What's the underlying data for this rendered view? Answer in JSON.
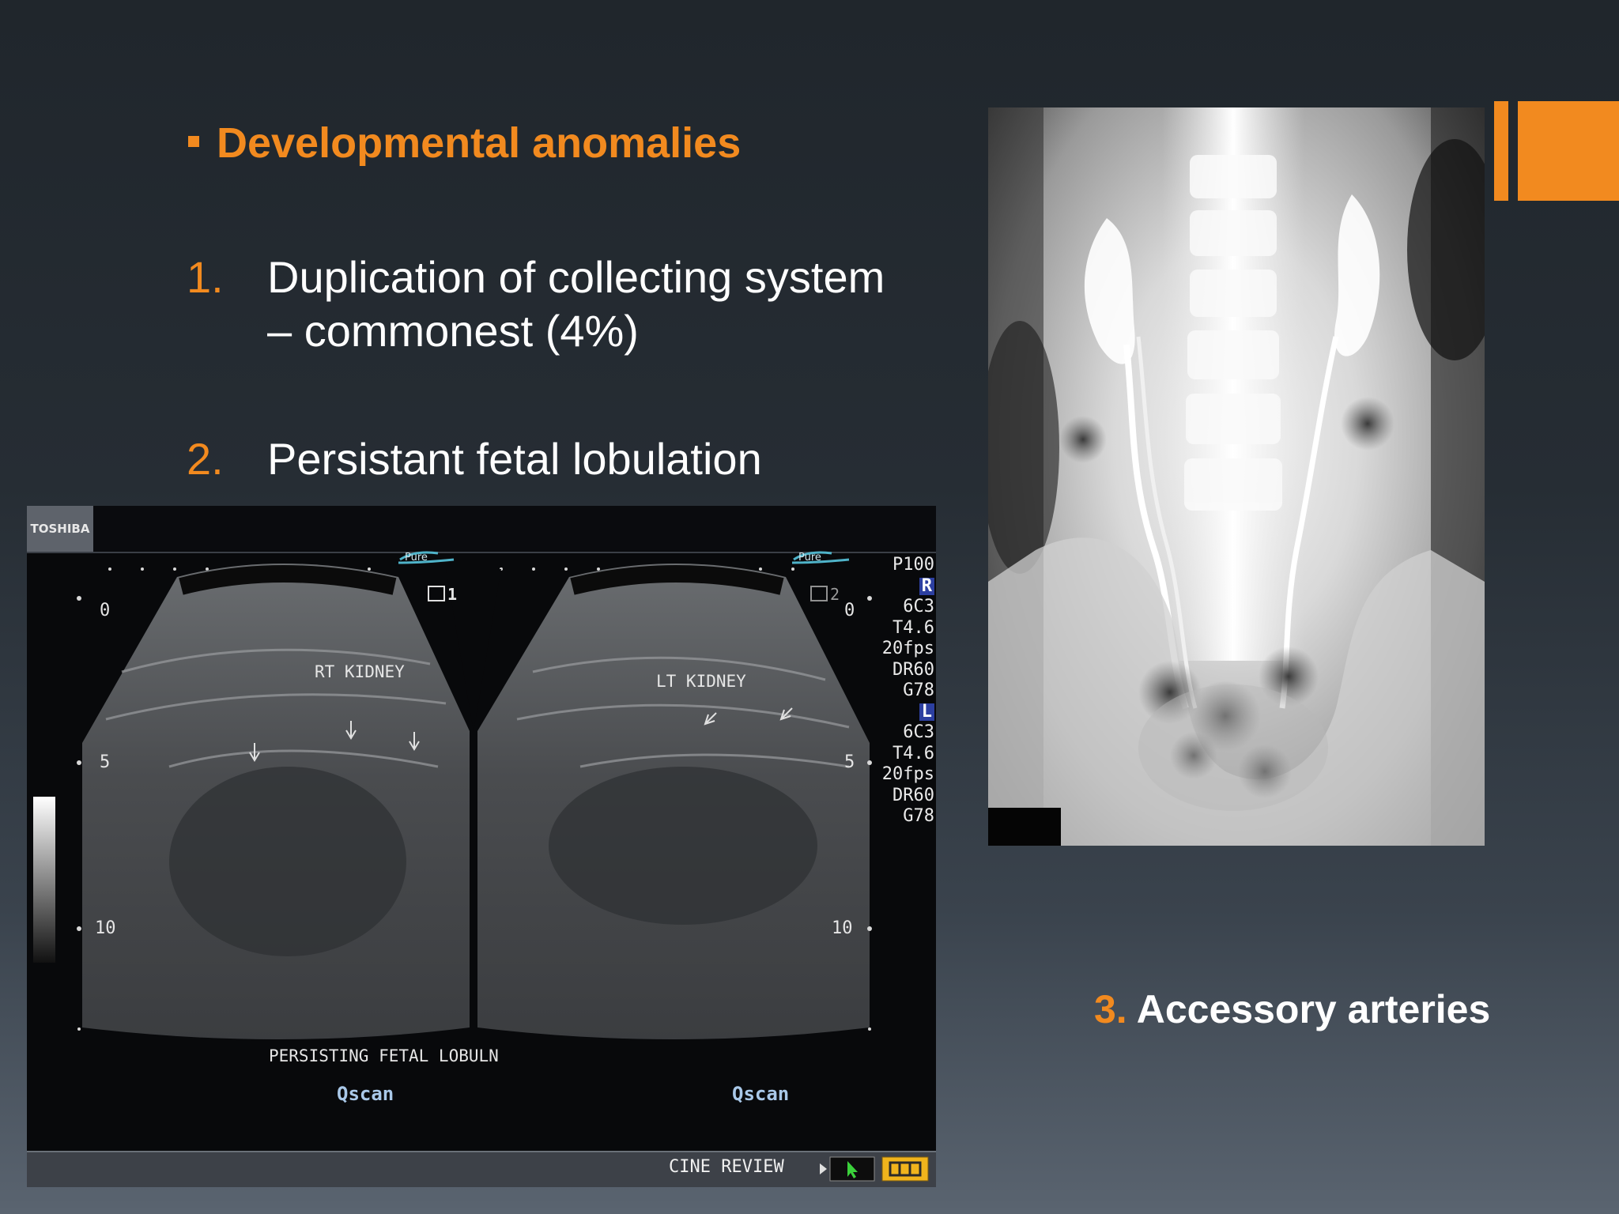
{
  "slide": {
    "heading": "Developmental anomalies",
    "items": [
      {
        "number": "1.",
        "line1": "Duplication of collecting system",
        "line2": "– commonest (4%)"
      },
      {
        "number": "2.",
        "line1": "Persistant fetal lobulation"
      }
    ],
    "item3": {
      "number": "3.",
      "text": "Accessory arteries"
    },
    "accent_color": "#f28a1f"
  },
  "ultrasound": {
    "brand": "TOSHIBA",
    "logo_left": "Pure",
    "logo_right": "Pure",
    "frame_left": "1",
    "frame_right": "2",
    "label_left": "RT KIDNEY",
    "label_right": "LT KIDNEY",
    "depth_marks": [
      "0",
      "5",
      "10"
    ],
    "caption": "PERSISTING FETAL LOBULN",
    "qscan_left": "Qscan",
    "qscan_right": "Qscan",
    "params": {
      "preset": "P100",
      "r_label": "R",
      "r_values": [
        "6C3",
        "T4.6",
        "20fps",
        "DR60",
        "G78"
      ],
      "l_label": "L",
      "l_values": [
        "6C3",
        "T4.6",
        "20fps",
        "DR60",
        "G78"
      ]
    },
    "cine_review": "CINE REVIEW"
  }
}
